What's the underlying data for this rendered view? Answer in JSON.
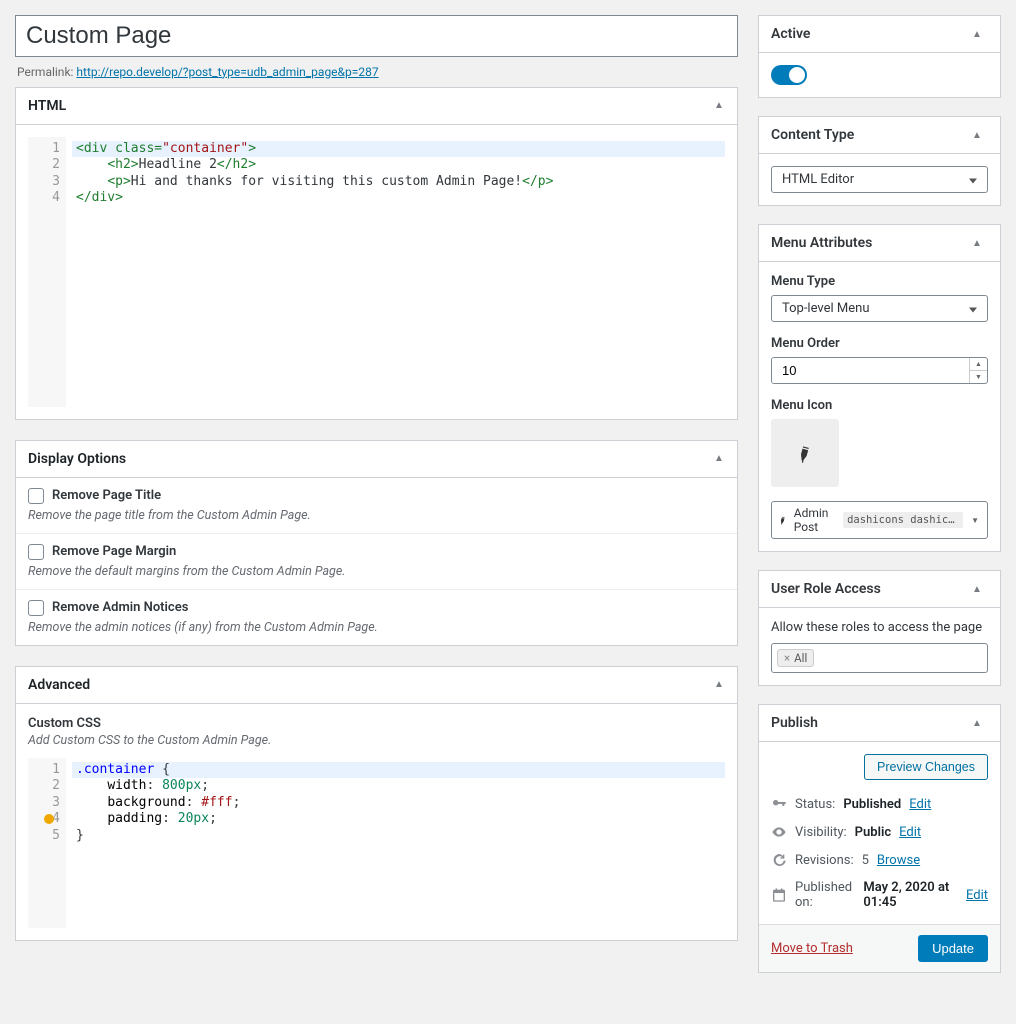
{
  "title": {
    "value": "Custom Page"
  },
  "permalink": {
    "label": "Permalink:",
    "url": "http://repo.develop/?post_type=udb_admin_page&p=287"
  },
  "html_box": {
    "title": "HTML",
    "lines": [
      "<div class=\"container\">",
      "    <h2>Headline 2</h2>",
      "    <p>Hi and thanks for visiting this custom Admin Page!</p>",
      "</div>"
    ]
  },
  "display_box": {
    "title": "Display Options",
    "options": [
      {
        "label": "Remove Page Title",
        "desc": "Remove the page title from the Custom Admin Page.",
        "checked": false
      },
      {
        "label": "Remove Page Margin",
        "desc": "Remove the default margins from the Custom Admin Page.",
        "checked": false
      },
      {
        "label": "Remove Admin Notices",
        "desc": "Remove the admin notices (if any) from the Custom Admin Page.",
        "checked": false
      }
    ]
  },
  "advanced_box": {
    "title": "Advanced",
    "css_label": "Custom CSS",
    "css_desc": "Add Custom CSS to the Custom Admin Page.",
    "css_lines": [
      ".container {",
      "    width: 800px;",
      "    background: #fff;",
      "    padding: 20px;",
      "}"
    ]
  },
  "active_box": {
    "title": "Active",
    "enabled": true
  },
  "content_type_box": {
    "title": "Content Type",
    "value": "HTML Editor"
  },
  "menu_attr_box": {
    "title": "Menu Attributes",
    "menu_type_label": "Menu Type",
    "menu_type_value": "Top-level Menu",
    "menu_order_label": "Menu Order",
    "menu_order_value": "10",
    "menu_icon_label": "Menu Icon",
    "admin_post_label": "Admin Post",
    "dashicon_code": "dashicons dashicons-adm..."
  },
  "role_box": {
    "title": "User Role Access",
    "label": "Allow these roles to access the page",
    "tags": [
      "All"
    ]
  },
  "publish_box": {
    "title": "Publish",
    "preview": "Preview Changes",
    "status_label": "Status:",
    "status_value": "Published",
    "status_edit": "Edit",
    "visibility_label": "Visibility:",
    "visibility_value": "Public",
    "visibility_edit": "Edit",
    "revisions_label": "Revisions:",
    "revisions_value": "5",
    "revisions_browse": "Browse",
    "published_label": "Published on:",
    "published_value": "May 2, 2020 at 01:45",
    "published_edit": "Edit",
    "trash": "Move to Trash",
    "update": "Update"
  }
}
